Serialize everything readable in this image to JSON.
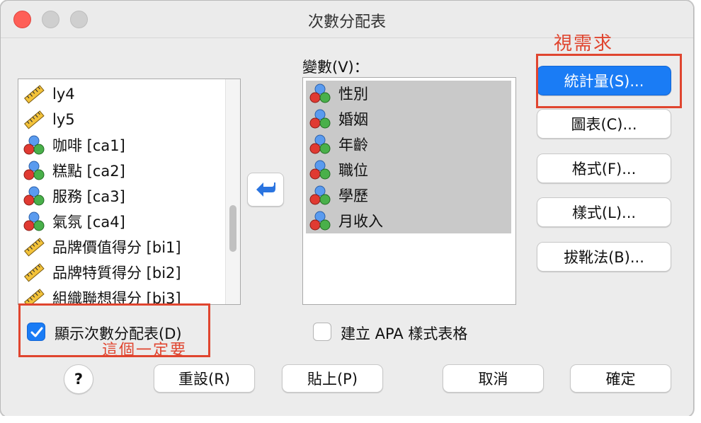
{
  "window": {
    "title": "次數分配表"
  },
  "source_list": {
    "items": [
      {
        "label": "ly4",
        "icon": "ruler-icon"
      },
      {
        "label": "ly5",
        "icon": "ruler-icon"
      },
      {
        "label": "咖啡 [ca1]",
        "icon": "nominal-balls-icon"
      },
      {
        "label": "糕點 [ca2]",
        "icon": "nominal-balls-icon"
      },
      {
        "label": "服務 [ca3]",
        "icon": "nominal-balls-icon"
      },
      {
        "label": "氣氛 [ca4]",
        "icon": "nominal-balls-icon"
      },
      {
        "label": "品牌價值得分 [bi1]",
        "icon": "ruler-icon"
      },
      {
        "label": "品牌特質得分 [bi2]",
        "icon": "ruler-icon"
      },
      {
        "label": "組織聯想得分 [bi3]",
        "icon": "ruler-icon"
      }
    ]
  },
  "variables": {
    "label": "變數(V)：",
    "items": [
      {
        "label": "性別"
      },
      {
        "label": "婚姻"
      },
      {
        "label": "年齡"
      },
      {
        "label": "職位"
      },
      {
        "label": "學歷"
      },
      {
        "label": "月收入"
      }
    ]
  },
  "buttons": {
    "statistics": "統計量(S)...",
    "charts": "圖表(C)...",
    "format": "格式(F)...",
    "style": "樣式(L)...",
    "bootstrap": "拔靴法(B)...",
    "help": "?",
    "reset": "重設(R)",
    "paste": "貼上(P)",
    "cancel": "取消",
    "ok": "確定"
  },
  "checkboxes": {
    "display_freq": {
      "label": "顯示次數分配表(D)",
      "checked": true
    },
    "apa": {
      "label": "建立 APA 樣式表格",
      "checked": false
    }
  },
  "annotations": {
    "as_needed": "視需求",
    "must_have": "這個一定要"
  },
  "colors": {
    "accent": "#1a7cf5",
    "annotation": "#e0452f"
  }
}
